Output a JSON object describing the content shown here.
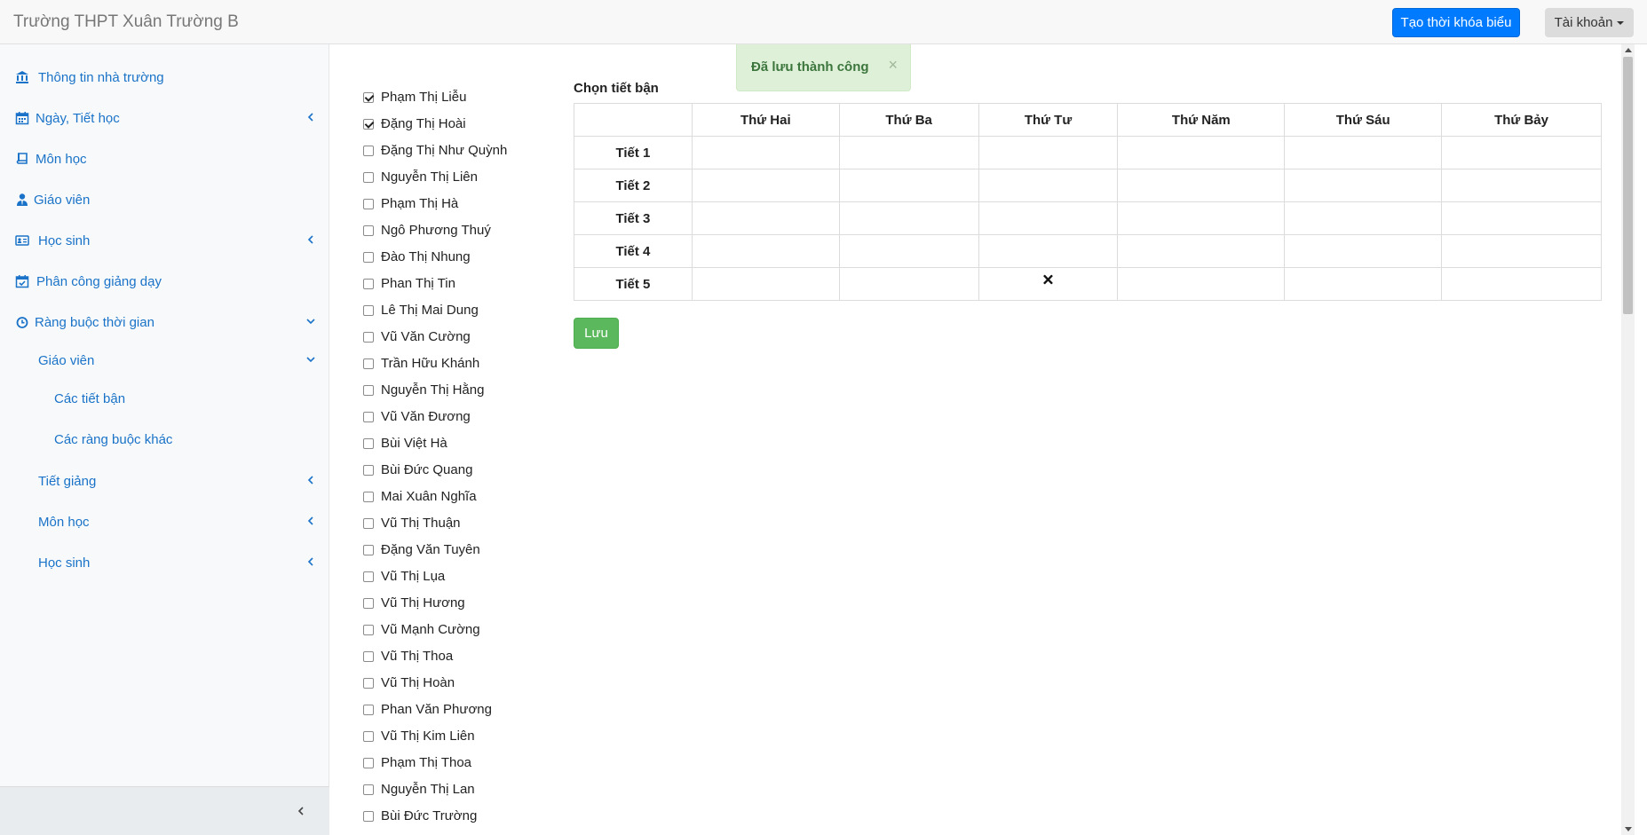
{
  "header": {
    "brand": "Trường THPT Xuân Trường B",
    "create_timetable_label": "Tạo thời khóa biểu",
    "account_label": "Tài khoản"
  },
  "sidebar": {
    "items": [
      {
        "label": "Thông tin nhà trường",
        "icon": "bank-icon"
      },
      {
        "label": "Ngày, Tiết học",
        "icon": "calendar-icon",
        "chevron": "left"
      },
      {
        "label": "Môn học",
        "icon": "book-icon"
      },
      {
        "label": "Giáo viên",
        "icon": "user-tie-icon"
      },
      {
        "label": "Học sinh",
        "icon": "id-card-icon",
        "chevron": "left"
      },
      {
        "label": "Phân công giảng dạy",
        "icon": "calendar-check-icon"
      },
      {
        "label": "Ràng buộc thời gian",
        "icon": "clock-icon",
        "chevron": "down"
      }
    ],
    "sub_items": [
      {
        "label": "Giáo viên",
        "chevron": "down"
      },
      {
        "label": "Các tiết bận"
      },
      {
        "label": "Các ràng buộc khác"
      },
      {
        "label": "Tiết giảng",
        "chevron": "left"
      },
      {
        "label": "Môn học",
        "chevron": "left"
      },
      {
        "label": "Học sinh",
        "chevron": "left"
      }
    ]
  },
  "alert": {
    "message": "Đã lưu thành công",
    "close": "×"
  },
  "teachers": [
    {
      "name": "Phạm Thị Liễu",
      "checked": true
    },
    {
      "name": "Đặng Thị Hoài",
      "checked": true
    },
    {
      "name": "Đặng Thị Như Quỳnh",
      "checked": false
    },
    {
      "name": "Nguyễn Thị Liên",
      "checked": false
    },
    {
      "name": "Phạm Thị Hà",
      "checked": false
    },
    {
      "name": "Ngô Phương Thuý",
      "checked": false
    },
    {
      "name": "Đào Thị Nhung",
      "checked": false
    },
    {
      "name": "Phan Thị Tin",
      "checked": false
    },
    {
      "name": "Lê Thị Mai Dung",
      "checked": false
    },
    {
      "name": "Vũ Văn Cường",
      "checked": false
    },
    {
      "name": "Trần Hữu Khánh",
      "checked": false
    },
    {
      "name": "Nguyễn Thị Hằng",
      "checked": false
    },
    {
      "name": "Vũ Văn Đương",
      "checked": false
    },
    {
      "name": "Bùi Việt Hà",
      "checked": false
    },
    {
      "name": "Bùi Đức Quang",
      "checked": false
    },
    {
      "name": "Mai Xuân Nghĩa",
      "checked": false
    },
    {
      "name": "Vũ Thị Thuận",
      "checked": false
    },
    {
      "name": "Đặng Văn Tuyên",
      "checked": false
    },
    {
      "name": "Vũ Thị Lụa",
      "checked": false
    },
    {
      "name": "Vũ Thị Hương",
      "checked": false
    },
    {
      "name": "Vũ Mạnh Cường",
      "checked": false
    },
    {
      "name": "Vũ Thị Thoa",
      "checked": false
    },
    {
      "name": "Vũ Thị Hoàn",
      "checked": false
    },
    {
      "name": "Phan Văn Phương",
      "checked": false
    },
    {
      "name": "Vũ Thị Kim Liên",
      "checked": false
    },
    {
      "name": "Phạm Thị Thoa",
      "checked": false
    },
    {
      "name": "Nguyễn Thị Lan",
      "checked": false
    },
    {
      "name": "Bùi Đức Trường",
      "checked": false
    }
  ],
  "schedule": {
    "title": "Chọn tiết bận",
    "days": [
      "Thứ Hai",
      "Thứ Ba",
      "Thứ Tư",
      "Thứ Năm",
      "Thứ Sáu",
      "Thứ Bảy"
    ],
    "periods": [
      "Tiết 1",
      "Tiết 2",
      "Tiết 3",
      "Tiết 4",
      "Tiết 5"
    ],
    "busy_mark": "🗙",
    "busy": [
      [
        false,
        false,
        false,
        false,
        false,
        false
      ],
      [
        false,
        false,
        false,
        false,
        false,
        false
      ],
      [
        false,
        false,
        false,
        false,
        false,
        false
      ],
      [
        false,
        false,
        false,
        false,
        false,
        false
      ],
      [
        false,
        false,
        true,
        false,
        false,
        false
      ]
    ],
    "save_label": "Lưu"
  },
  "colors": {
    "primary": "#007bff",
    "success": "#5cb85c",
    "link": "#1a73c8",
    "alert_bg": "#dff0d8",
    "alert_text": "#3c763d"
  }
}
